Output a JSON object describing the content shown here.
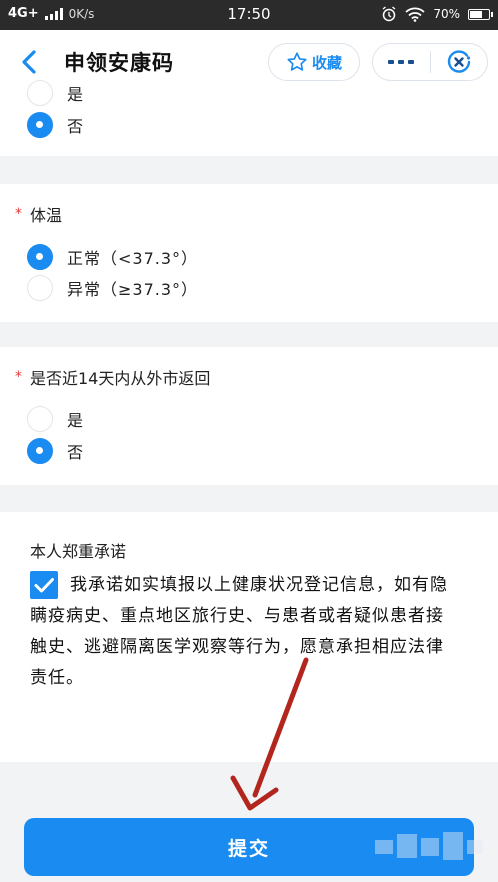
{
  "status_bar": {
    "network": "4G+",
    "speed": "0K/s",
    "time": "17:50",
    "battery": "70%",
    "battery_level": 0.7
  },
  "nav": {
    "title": "申领安康码",
    "favorite_label": "收藏"
  },
  "questions": [
    {
      "id": "prev",
      "title": "",
      "options": [
        {
          "label": "是",
          "selected": false
        },
        {
          "label": "否",
          "selected": true
        }
      ]
    },
    {
      "id": "temperature",
      "title": "体温",
      "required_mark": "*",
      "options": [
        {
          "label": "正常（<37.3°）",
          "selected": true
        },
        {
          "label": "异常（≥37.3°）",
          "selected": false
        }
      ]
    },
    {
      "id": "returned",
      "title": "是否近14天内从外市返回",
      "required_mark": "*",
      "options": [
        {
          "label": "是",
          "selected": false
        },
        {
          "label": "否",
          "selected": true
        }
      ]
    }
  ],
  "pledge": {
    "title": "本人郑重承诺",
    "checked": true,
    "text": "我承诺如实填报以上健康状况登记信息，如有隐瞒疫病史、重点地区旅行史、与患者或者疑似患者接触史、逃避隔离医学观察等行为，愿意承担相应法律责任。"
  },
  "submit_label": "提交",
  "colors": {
    "accent": "#1a8bf0",
    "required": "#e53935",
    "annotation_arrow": "#b3261e"
  }
}
